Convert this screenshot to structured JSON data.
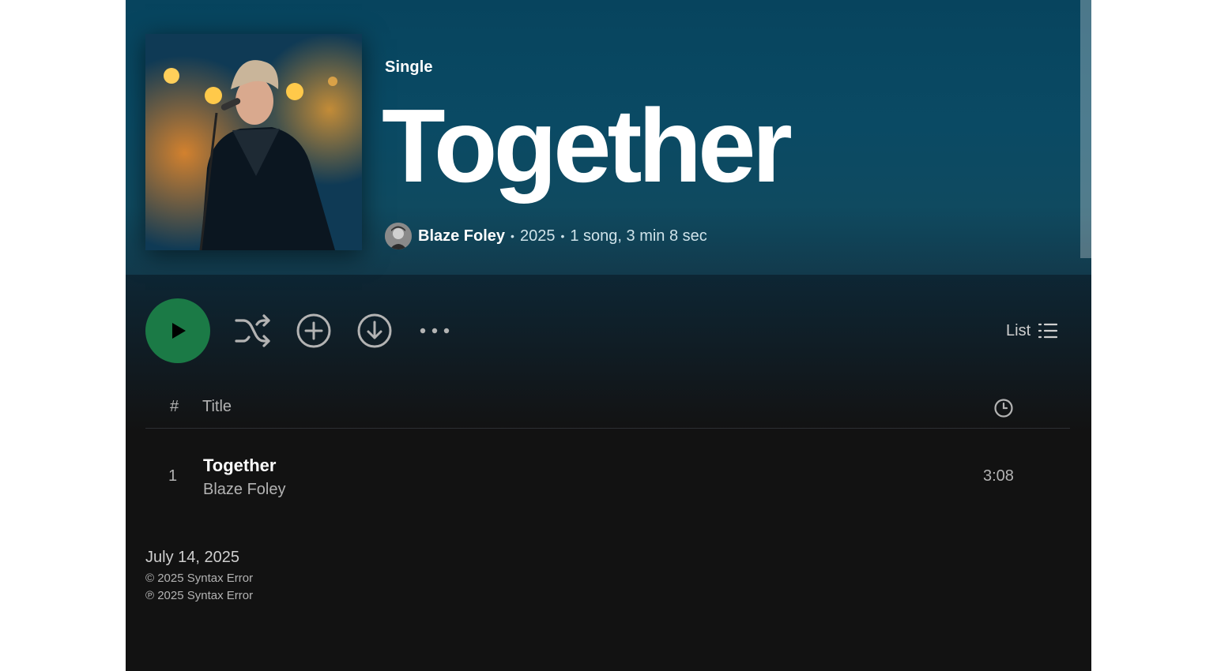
{
  "album": {
    "type_label": "Single",
    "title": "Together",
    "artist": "Blaze Foley",
    "year": "2025",
    "summary": "1 song, 3 min 8 sec",
    "separator": "•"
  },
  "actions": {
    "icons": [
      "play-icon",
      "shuffle-icon",
      "add-circle-icon",
      "download-icon",
      "more-options-icon"
    ],
    "view_label": "List"
  },
  "table": {
    "headers": {
      "number": "#",
      "title": "Title"
    },
    "tracks": [
      {
        "number": "1",
        "title": "Together",
        "artist": "Blaze Foley",
        "duration": "3:08"
      }
    ]
  },
  "footer": {
    "release_date": "July 14, 2025",
    "copyright": "© 2025 Syntax Error",
    "phonogram": "℗ 2025 Syntax Error"
  },
  "colors": {
    "accent": "#1b7a46",
    "hero_bg": "#0a4a64",
    "page_bg": "#121212"
  }
}
